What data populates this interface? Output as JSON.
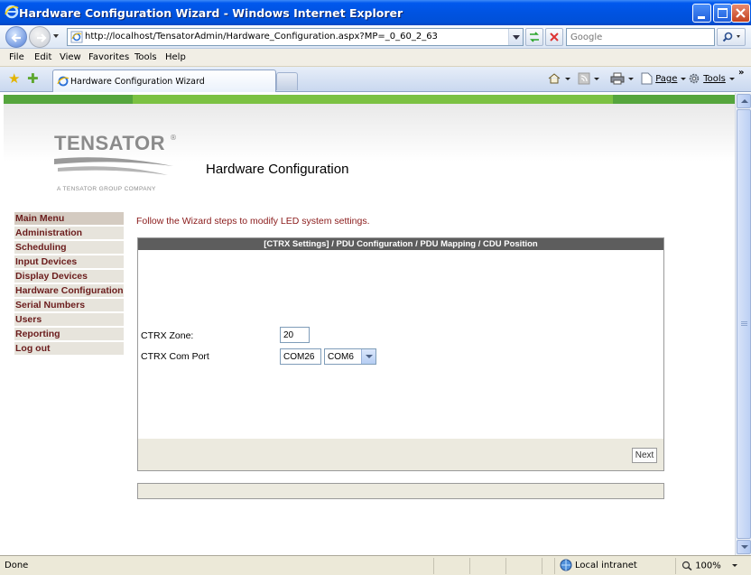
{
  "window": {
    "title": "Hardware Configuration Wizard - Windows Internet Explorer"
  },
  "address_bar": {
    "url": "http://localhost/TensatorAdmin/Hardware_Configuration.aspx?MP=_0_60_2_63",
    "search_placeholder": "Google"
  },
  "menu": [
    "File",
    "Edit",
    "View",
    "Favorites",
    "Tools",
    "Help"
  ],
  "tab": {
    "label": "Hardware Configuration Wizard"
  },
  "command_bar": {
    "page_label": "Page",
    "tools_label": "Tools"
  },
  "logo": {
    "name": "TENSATOR",
    "reg_mark": "®",
    "tagline": "A TENSATOR GROUP COMPANY"
  },
  "page": {
    "title": "Hardware Configuration",
    "instruction": "Follow the Wizard steps to modify LED system settings."
  },
  "sidebar": {
    "items": [
      "Main Menu",
      "Administration",
      "Scheduling",
      "Input Devices",
      "Display Devices",
      "Hardware Configuration",
      "Serial Numbers",
      "Users",
      "Reporting",
      "Log out"
    ]
  },
  "wizard": {
    "steps_header": "[CTRX Settings] / PDU Configuration / PDU Mapping / CDU Position",
    "zone_label": "CTRX Zone:",
    "zone_value": "20",
    "com_port_label": "CTRX Com Port",
    "com_port_value": "COM26",
    "com_port_select": "COM6",
    "next_label": "Next"
  },
  "status_bar": {
    "status": "Done",
    "zone": "Local intranet",
    "zoom": "100%"
  },
  "colors": {
    "green_stripe": "#7bc142",
    "sidebar_text": "#6b1c1c",
    "instruction_text": "#8a1a1a",
    "wizard_header": "#5d5d5d"
  }
}
